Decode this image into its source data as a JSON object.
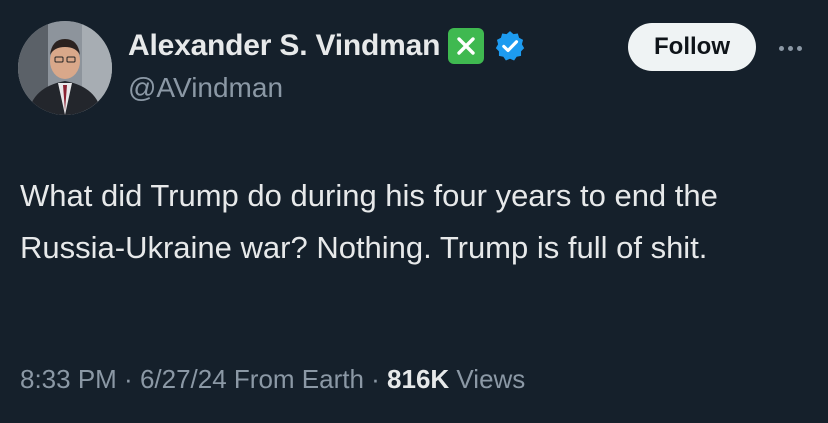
{
  "author": {
    "display_name": "Alexander S. Vindman",
    "handle": "@AVindman",
    "badges": [
      "x-checkmark-badge-icon",
      "verified-badge-icon"
    ]
  },
  "actions": {
    "follow_label": "Follow",
    "more_icon": "more-options-icon"
  },
  "tweet": {
    "text": "What did Trump do during his four years to end the Russia-Ukraine war? Nothing. Trump is full of shit."
  },
  "meta": {
    "time": "8:33 PM",
    "sep1": " · ",
    "date": "6/27/24",
    "source": " From Earth",
    "sep2": " · ",
    "views_count": "816K",
    "views_label": " Views"
  },
  "colors": {
    "background": "#15202b",
    "text_primary": "#e7e9ea",
    "text_secondary": "#8b98a5",
    "verified_blue": "#1d9bf0",
    "x_badge_green": "#3fb950",
    "follow_bg": "#eff3f4"
  }
}
